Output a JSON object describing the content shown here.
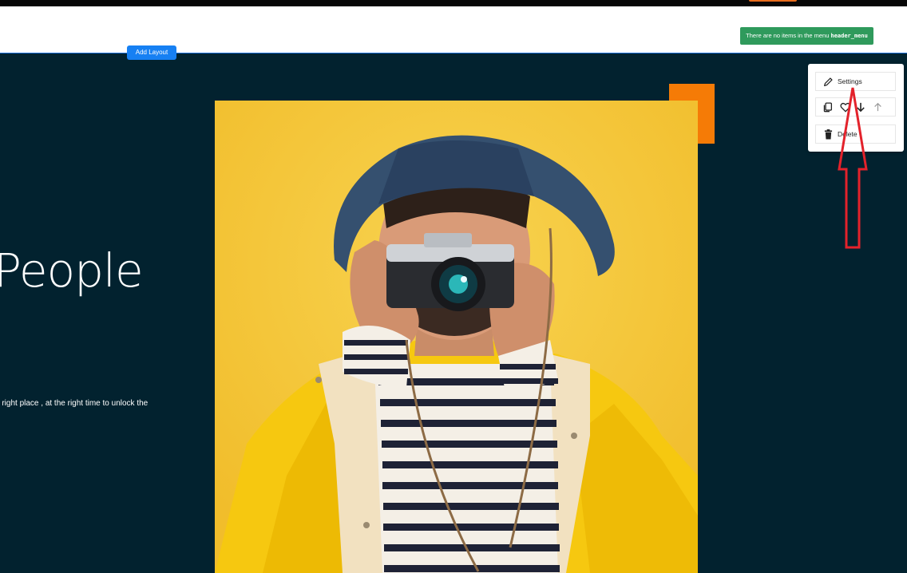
{
  "header": {
    "menu_notice": "There are no items in the menu",
    "menu_notice_code": "header_menu"
  },
  "add_layout_label": "Add Layout",
  "hero": {
    "headline": "People",
    "subtext": "e right place , at the right time to unlock the"
  },
  "toolbar": {
    "settings_label": "Settings",
    "delete_label": "Delete",
    "icons": [
      "pencil-icon",
      "copy-icon",
      "heart-icon",
      "arrow-down-icon",
      "arrow-up-icon",
      "trash-icon"
    ]
  },
  "colors": {
    "page_bg": "#02222f",
    "accent_orange": "#f57b06",
    "notice_green": "#2f9a5c",
    "button_blue": "#1680f3",
    "annotation_red": "#e3222b",
    "photo_bg": "#f5c935",
    "jacket_yellow": "#f6c810"
  }
}
